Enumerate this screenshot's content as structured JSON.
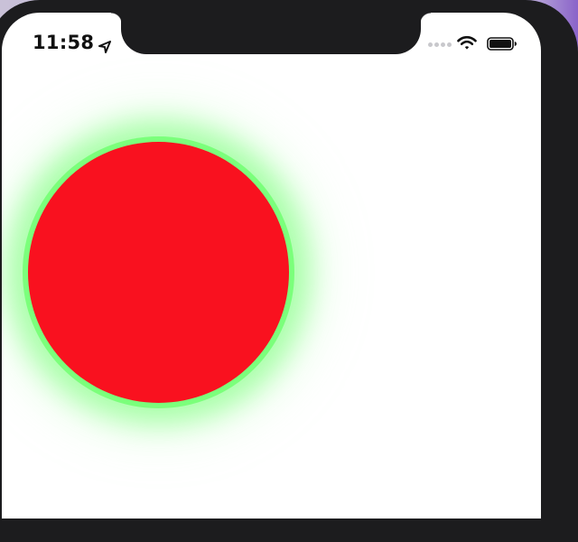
{
  "status_bar": {
    "time": "11:58",
    "location_icon": "location-arrow-icon",
    "signal_icon": "cellular-signal-icon",
    "wifi_icon": "wifi-icon",
    "battery_icon": "battery-icon"
  },
  "content": {
    "circle_fill": "#f9111f",
    "circle_glow": "#76ff76"
  },
  "colors": {
    "device_frame": "#1c1c1e",
    "screen_background": "#ffffff"
  }
}
